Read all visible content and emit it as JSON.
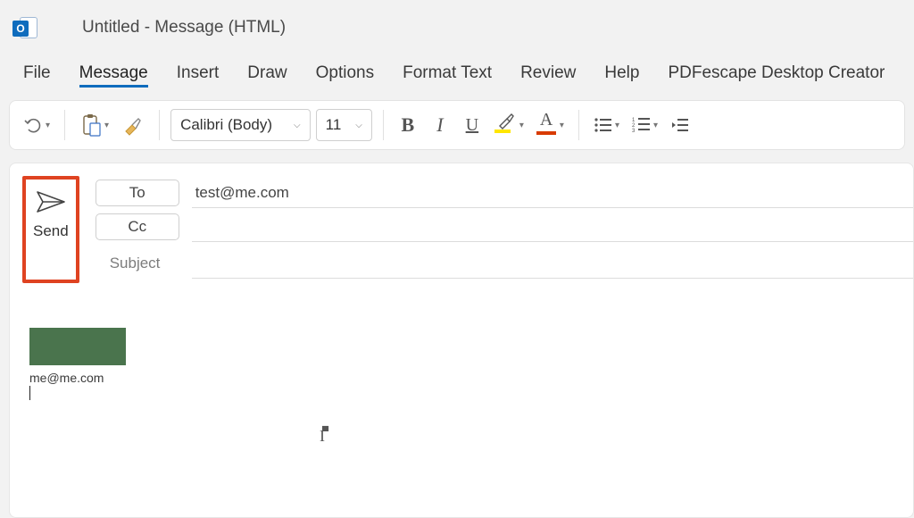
{
  "window": {
    "title": "Untitled  -  Message (HTML)",
    "logo_letter": "O"
  },
  "menu": {
    "items": [
      "File",
      "Message",
      "Insert",
      "Draw",
      "Options",
      "Format Text",
      "Review",
      "Help",
      "PDFescape Desktop Creator"
    ],
    "active_index": 1
  },
  "toolbar": {
    "font_name": "Calibri (Body)",
    "font_size": "11"
  },
  "compose": {
    "send_label": "Send",
    "to_label": "To",
    "cc_label": "Cc",
    "subject_label": "Subject",
    "to_value": "test@me.com",
    "cc_value": "",
    "subject_value": ""
  },
  "body": {
    "signature_email": "me@me.com"
  }
}
